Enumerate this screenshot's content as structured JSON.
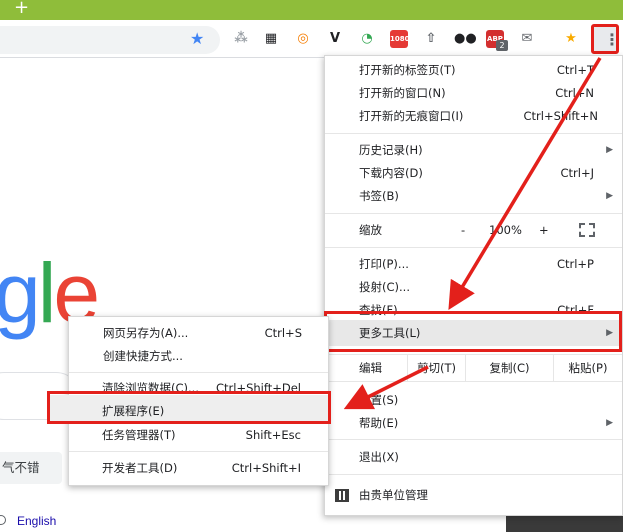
{
  "tabstrip": {
    "new_tab_glyph": "+"
  },
  "toolbar": {
    "bookmark_star": "★",
    "extensions": [
      {
        "name": "sitemap-extension-icon",
        "text": "⁂",
        "color": "#9aa0a6"
      },
      {
        "name": "qr-code-extension-icon",
        "text": "▦",
        "color": "#202124"
      },
      {
        "name": "orange-circle-extension-icon",
        "text": "◎",
        "color": "#f57c00"
      },
      {
        "name": "v-extension-icon",
        "text": "V",
        "color": "#202124"
      },
      {
        "name": "speed-gauge-extension-icon",
        "text": "◔",
        "color": "#34a853"
      },
      {
        "name": "video-1080-extension-icon",
        "text": "1080",
        "color": "#e53935"
      },
      {
        "name": "upload-extension-icon",
        "text": "⇧",
        "color": "#5f6368"
      },
      {
        "name": "owl-extension-icon",
        "text": "●●",
        "color": "#202124"
      },
      {
        "name": "abp-extension-icon",
        "text": "ABP",
        "color": "#d32f2f"
      },
      {
        "name": "mail-extension-icon",
        "text": "✉",
        "color": "#5f6368"
      },
      {
        "name": "puzzle-extension-icon",
        "text": "★",
        "color": "#f9ab00"
      }
    ],
    "abp_badge": "2",
    "menu_dots": "⋮"
  },
  "page": {
    "logo_letters": [
      "g",
      "l",
      "e"
    ],
    "suggest_text": "气不错",
    "language_link": "English"
  },
  "menu": {
    "new_tab": {
      "label": "打开新的标签页(T)",
      "shortcut": "Ctrl+T"
    },
    "new_window": {
      "label": "打开新的窗口(N)",
      "shortcut": "Ctrl+N"
    },
    "new_incognito": {
      "label": "打开新的无痕窗口(I)",
      "shortcut": "Ctrl+Shift+N"
    },
    "history": {
      "label": "历史记录(H)"
    },
    "downloads": {
      "label": "下载内容(D)",
      "shortcut": "Ctrl+J"
    },
    "bookmarks": {
      "label": "书签(B)"
    },
    "zoom": {
      "label": "缩放",
      "minus": "-",
      "value": "100%",
      "plus": "+"
    },
    "print": {
      "label": "打印(P)...",
      "shortcut": "Ctrl+P"
    },
    "cast": {
      "label": "投射(C)..."
    },
    "find": {
      "label": "查找(F)...",
      "shortcut": "Ctrl+F"
    },
    "more_tools": {
      "label": "更多工具(L)"
    },
    "edit": {
      "label": "编辑",
      "cut": "剪切(T)",
      "copy": "复制(C)",
      "paste": "粘贴(P)"
    },
    "settings": {
      "label": "设置(S)"
    },
    "help": {
      "label": "帮助(E)"
    },
    "exit": {
      "label": "退出(X)"
    },
    "managed": {
      "label": "由贵单位管理"
    },
    "submenu_arrow": "▶"
  },
  "submenu": {
    "save_page": {
      "label": "网页另存为(A)...",
      "shortcut": "Ctrl+S"
    },
    "create_shortcut": {
      "label": "创建快捷方式..."
    },
    "clear_data": {
      "label": "清除浏览数据(C)...",
      "shortcut": "Ctrl+Shift+Del"
    },
    "extensions": {
      "label": "扩展程序(E)"
    },
    "task_manager": {
      "label": "任务管理器(T)",
      "shortcut": "Shift+Esc"
    },
    "dev_tools": {
      "label": "开发者工具(D)",
      "shortcut": "Ctrl+Shift+I"
    }
  },
  "annotation": {
    "highlight_color": "#e3201b"
  }
}
